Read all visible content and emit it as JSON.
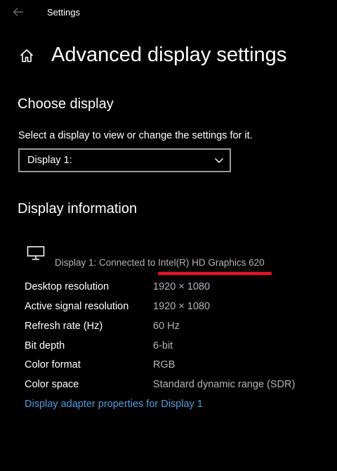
{
  "window": {
    "title": "Settings",
    "back_icon": "arrow-left-icon"
  },
  "page": {
    "title": "Advanced display settings",
    "home_icon": "home-icon"
  },
  "choose_display": {
    "heading": "Choose display",
    "description": "Select a display to view or change the settings for it.",
    "dropdown_value": "Display 1:",
    "dropdown_icon": "chevron-down-icon"
  },
  "display_information": {
    "heading": "Display information",
    "monitor_icon": "monitor-icon",
    "connected_text": "Display 1: Connected to Intel(R) HD Graphics 620",
    "rows": [
      {
        "label": "Desktop resolution",
        "value": "1920 × 1080"
      },
      {
        "label": "Active signal resolution",
        "value": "1920 × 1080"
      },
      {
        "label": "Refresh rate (Hz)",
        "value": "60 Hz"
      },
      {
        "label": "Bit depth",
        "value": "6-bit"
      },
      {
        "label": "Color format",
        "value": "RGB"
      },
      {
        "label": "Color space",
        "value": "Standard dynamic range (SDR)"
      }
    ],
    "adapter_link": "Display adapter properties for Display 1"
  },
  "colors": {
    "background": "#000000",
    "text": "#ffffff",
    "secondary_text": "#b3b3b3",
    "link": "#4c9ee0",
    "annotation": "#e81123"
  }
}
